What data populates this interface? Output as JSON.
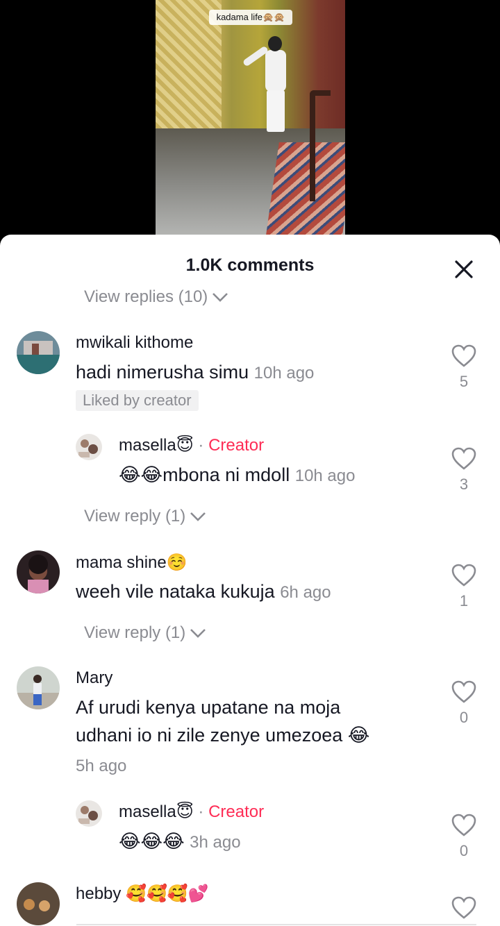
{
  "video": {
    "label": "kadama life🙊🙊"
  },
  "sheet": {
    "title": "1.0K comments"
  },
  "top_view_replies": "View replies (10)",
  "comments": [
    {
      "username": "mwikali kithome",
      "text": "hadi nimerusha simu",
      "time": "10h ago",
      "badge": "Liked by creator",
      "likes": "5"
    },
    {
      "username": "masella😇",
      "creator_dot": "·",
      "creator_label": "Creator",
      "text": "😂😂mbona ni mdoll",
      "time": "10h ago",
      "likes": "3"
    },
    {
      "view_reply": "View reply (1)"
    },
    {
      "username": "mama shine☺️",
      "text": "weeh vile nataka kukuja",
      "time": "6h ago",
      "likes": "1"
    },
    {
      "view_reply": "View reply (1)"
    },
    {
      "username": "Mary",
      "text_line1": "Af urudi kenya upatane na moja",
      "text_line2": "udhani io ni zile zenye umezoea 😂",
      "time": "5h ago",
      "likes": "0"
    },
    {
      "username": "masella😇",
      "creator_dot": "·",
      "creator_label": "Creator",
      "text": "😂😂😂",
      "time": "3h ago",
      "likes": "0"
    },
    {
      "username": "hebby 🥰🥰🥰💕"
    }
  ],
  "colors": {
    "creator": "#fe2c55",
    "secondary_text": "#8a8b91",
    "primary_text": "#161823"
  },
  "icons": {
    "close": "close-icon",
    "like": "heart-outline-icon",
    "expand": "chevron-down-icon"
  }
}
